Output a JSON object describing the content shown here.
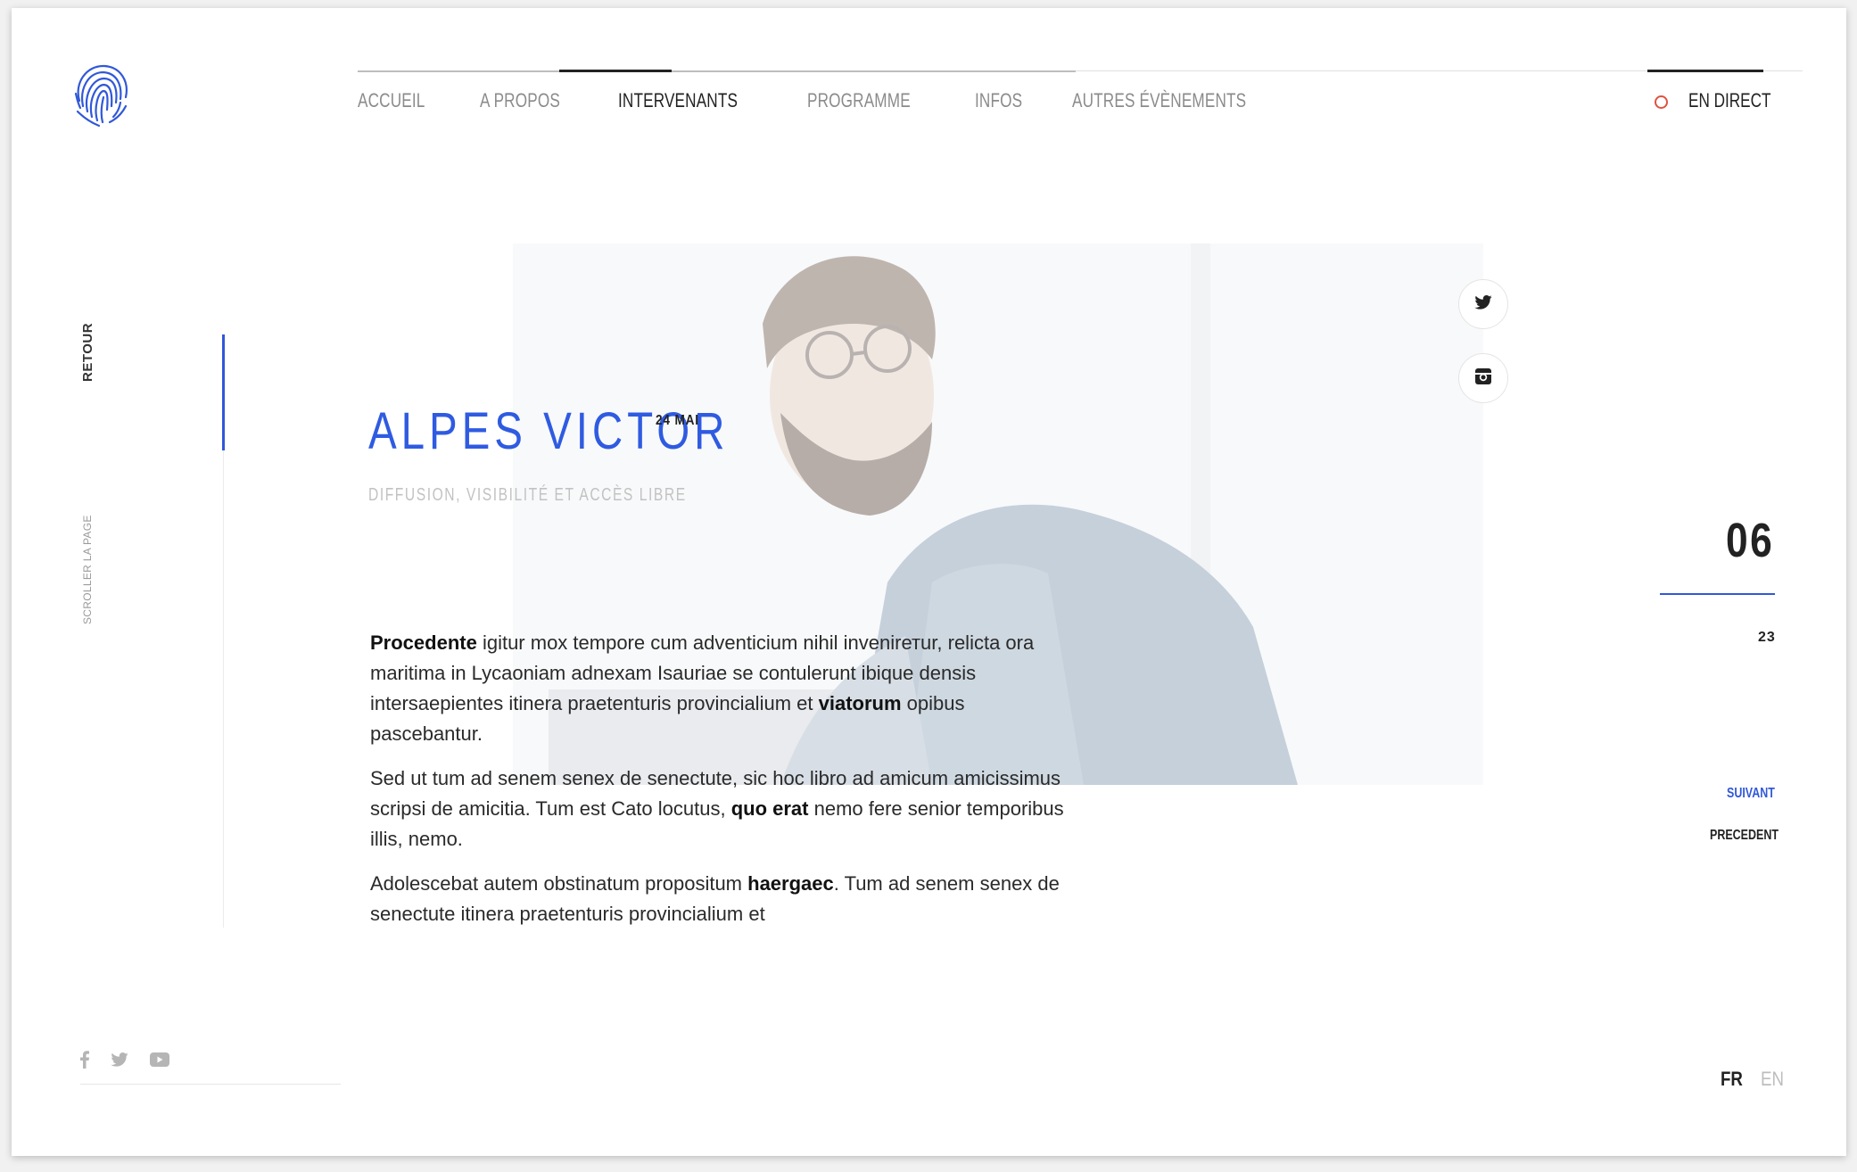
{
  "nav": {
    "items": [
      {
        "label": "ACCUEIL"
      },
      {
        "label": "A PROPOS"
      },
      {
        "label": "INTERVENANTS"
      },
      {
        "label": "PROGRAMME"
      },
      {
        "label": "INFOS"
      },
      {
        "label": "AUTRES ÉVÈNEMENTS"
      }
    ],
    "active": "INTERVENANTS",
    "live_label": "EN DIRECT"
  },
  "sidebar": {
    "back_label": "RETOUR",
    "scroll_label": "SCROLLER LA PAGE"
  },
  "speaker": {
    "name": "ALPES VICTOR",
    "date": "24 MAI",
    "subtitle": "DIFFUSION, VISIBILITÉ ET ACCÈS LIBRE"
  },
  "body": {
    "p1": {
      "b1": "Procedente",
      "t1": " igitur mox tempore cum adventicium nihil invenirетur, relicta ora maritima in Lycaoniam adnexam Isauriae se contulerunt ibique densis intersaepientes itinera praetenturis provincialium et ",
      "b2": "viatorum",
      "t2": " opibus pascebantur."
    },
    "p2": {
      "t1": "Sed ut tum ad senem senex de senectute, sic hoc libro ad amicum amicissimus scripsi de amicitia. Tum est Cato locutus, ",
      "b1": "quo erat",
      "t2": " nemo fere senior temporibus illis, nemo."
    },
    "p3": {
      "t1": "Adolescebat autem obstinatum propositum ",
      "b1": "haergaec",
      "t2": ". Tum ad senem senex de senectute itinera praetenturis provincialium et"
    }
  },
  "counter": {
    "current": "06",
    "total": "23",
    "next_label": "SUIVANT",
    "prev_label": "PRECEDENT"
  },
  "footer": {
    "icons": [
      "facebook-icon",
      "twitter-icon",
      "youtube-icon"
    ],
    "lang_active": "FR",
    "lang_other": "EN"
  },
  "colors": {
    "accent": "#3158d8",
    "live_dot": "#e0523f",
    "text": "#222222"
  }
}
